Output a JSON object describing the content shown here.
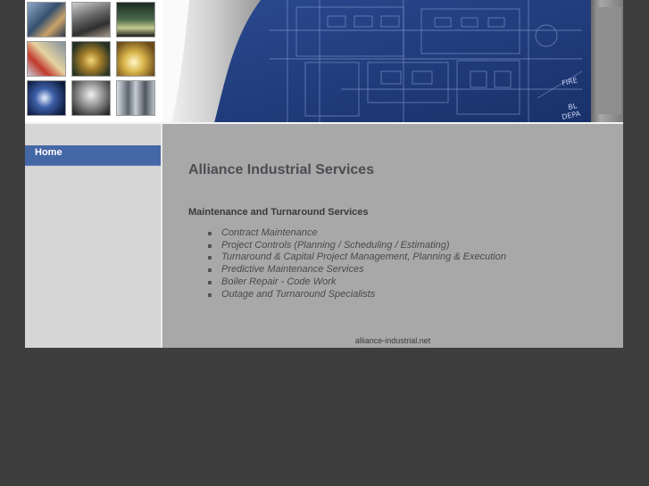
{
  "nav": {
    "items": [
      {
        "label": "Home"
      }
    ]
  },
  "content": {
    "title": "Alliance Industrial Services",
    "section_heading": "Maintenance and Turnaround Services",
    "services": [
      "Contract Maintenance",
      "Project Controls (Planning / Scheduling / Estimating)",
      "Turnaround & Capital Project Management, Planning & Execution",
      "Predictive Maintenance Services",
      "Boiler Repair - Code Work",
      "Outage and Turnaround Specialists"
    ]
  },
  "footer": {
    "domain": "alliance-industrial.net"
  },
  "colors": {
    "page_background": "#3e3e3e",
    "nav_active": "#4467a6",
    "sidebar": "#d6d6d6",
    "content": "#a8a8a8",
    "blueprint": "#223d7e"
  }
}
